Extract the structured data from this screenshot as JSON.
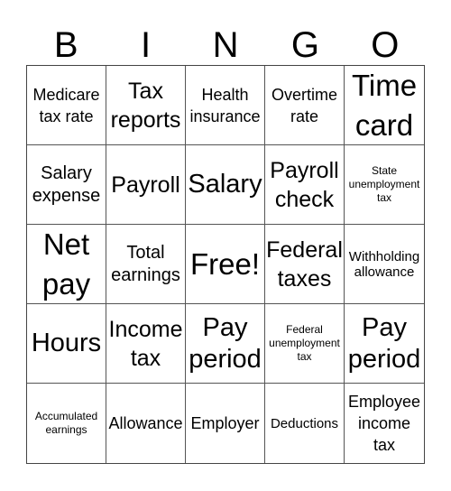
{
  "header": {
    "letters": [
      "B",
      "I",
      "N",
      "G",
      "O"
    ]
  },
  "cells": [
    {
      "text": "Medicare tax rate",
      "size": "md"
    },
    {
      "text": "Tax reports",
      "size": "lg"
    },
    {
      "text": "Health insurance",
      "size": "md"
    },
    {
      "text": "Overtime rate",
      "size": "md"
    },
    {
      "text": "Time card",
      "size": "xxl"
    },
    {
      "text": "Salary expense",
      "size": "md2"
    },
    {
      "text": "Payroll",
      "size": "lg"
    },
    {
      "text": "Salary",
      "size": "xl"
    },
    {
      "text": "Payroll check",
      "size": "lg"
    },
    {
      "text": "State unemployment tax",
      "size": "xs"
    },
    {
      "text": "Net pay",
      "size": "xxl"
    },
    {
      "text": "Total earnings",
      "size": "md2"
    },
    {
      "text": "Free!",
      "size": "xxl"
    },
    {
      "text": "Federal taxes",
      "size": "lg"
    },
    {
      "text": "Withholding allowance",
      "size": "sm"
    },
    {
      "text": "Hours",
      "size": "xl"
    },
    {
      "text": "Income tax",
      "size": "lg"
    },
    {
      "text": "Pay period",
      "size": "xl"
    },
    {
      "text": "Federal unemployment tax",
      "size": "xs"
    },
    {
      "text": "Pay period",
      "size": "xl"
    },
    {
      "text": "Accumulated earnings",
      "size": "xs"
    },
    {
      "text": "Allowance",
      "size": "md"
    },
    {
      "text": "Employer",
      "size": "md"
    },
    {
      "text": "Deductions",
      "size": "sm"
    },
    {
      "text": "Employee income tax",
      "size": "md"
    }
  ]
}
